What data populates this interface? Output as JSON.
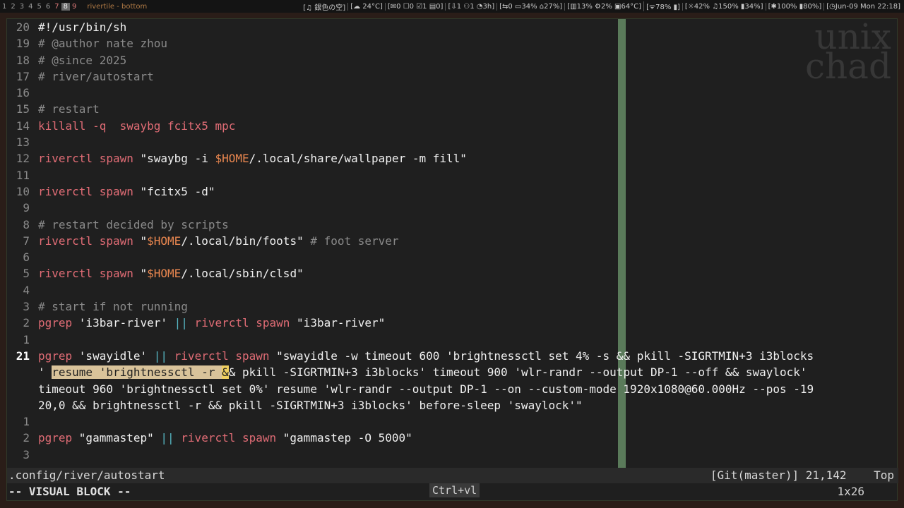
{
  "topbar": {
    "tags": [
      "1",
      "2",
      "3",
      "4",
      "5",
      "6",
      "7",
      "8",
      "9"
    ],
    "active_tag": "8",
    "window_title": "rivertile - bottom",
    "status": [
      "[♫ 銀色の空]",
      "[☁ 24°C]",
      "[✉0 ☐0 ☑1 ▤0]",
      "[⇩1 ⚇1 ◔3h]",
      "[⇆0 ▭34% ⌂27%]",
      "[▥13% ⚙2% ▣64°C]",
      "[ᯤ78% ▮]",
      "[☼42% ♫150% ▮34%]",
      "[✱100% ▮80%]",
      "[◷Jun-09 Mon 22:18]"
    ]
  },
  "watermark": {
    "line1": "unix",
    "line2": "chad"
  },
  "lines": [
    {
      "n": "20",
      "segs": [
        {
          "t": "#!/usr/bin/sh",
          "c": "str"
        }
      ]
    },
    {
      "n": "19",
      "segs": [
        {
          "t": "# @author nate zhou",
          "c": "cmt"
        }
      ]
    },
    {
      "n": "18",
      "segs": [
        {
          "t": "# @since 2025",
          "c": "cmt"
        }
      ]
    },
    {
      "n": "17",
      "segs": [
        {
          "t": "# river/autostart",
          "c": "cmt"
        }
      ]
    },
    {
      "n": "16",
      "segs": []
    },
    {
      "n": "15",
      "segs": [
        {
          "t": "# restart",
          "c": "cmt"
        }
      ]
    },
    {
      "n": "14",
      "segs": [
        {
          "t": "killall -q  swaybg fcitx5 mpc",
          "c": "cmd"
        }
      ]
    },
    {
      "n": "13",
      "segs": []
    },
    {
      "n": "12",
      "segs": [
        {
          "t": "riverctl spawn ",
          "c": "cmd"
        },
        {
          "t": "\"swaybg -i ",
          "c": "str"
        },
        {
          "t": "$HOME",
          "c": "var"
        },
        {
          "t": "/.local/share/wallpaper -m fill\"",
          "c": "str"
        }
      ]
    },
    {
      "n": "11",
      "segs": []
    },
    {
      "n": "10",
      "segs": [
        {
          "t": "riverctl spawn ",
          "c": "cmd"
        },
        {
          "t": "\"fcitx5 -d\"",
          "c": "str"
        }
      ]
    },
    {
      "n": "9",
      "segs": []
    },
    {
      "n": "8",
      "segs": [
        {
          "t": "# restart decided by scripts",
          "c": "cmt"
        }
      ]
    },
    {
      "n": "7",
      "segs": [
        {
          "t": "riverctl spawn ",
          "c": "cmd"
        },
        {
          "t": "\"",
          "c": "str"
        },
        {
          "t": "$HOME",
          "c": "var"
        },
        {
          "t": "/.local/bin/foots\"",
          "c": "str"
        },
        {
          "t": " # foot server",
          "c": "cmt"
        }
      ]
    },
    {
      "n": "6",
      "segs": []
    },
    {
      "n": "5",
      "segs": [
        {
          "t": "riverctl spawn ",
          "c": "cmd"
        },
        {
          "t": "\"",
          "c": "str"
        },
        {
          "t": "$HOME",
          "c": "var"
        },
        {
          "t": "/.local/sbin/clsd\"",
          "c": "str"
        }
      ]
    },
    {
      "n": "4",
      "segs": []
    },
    {
      "n": "3",
      "segs": [
        {
          "t": "# start if not running",
          "c": "cmt"
        }
      ]
    },
    {
      "n": "2",
      "segs": [
        {
          "t": "pgrep ",
          "c": "cmd"
        },
        {
          "t": "'i3bar-river' ",
          "c": "str"
        },
        {
          "t": "||",
          "c": "op"
        },
        {
          "t": " riverctl spawn ",
          "c": "cmd"
        },
        {
          "t": "\"i3bar-river\"",
          "c": "str"
        }
      ]
    },
    {
      "n": "1",
      "segs": []
    },
    {
      "n": "21",
      "cur": true,
      "segs": [
        {
          "t": "pgrep ",
          "c": "cmd"
        },
        {
          "t": "'swayidle' ",
          "c": "str"
        },
        {
          "t": "||",
          "c": "op"
        },
        {
          "t": " riverctl spawn ",
          "c": "cmd"
        },
        {
          "t": "\"swayidle -w timeout 600 'brightnessctl set 4% -s && pkill -SIGRTMIN+3 i3blocks",
          "c": "str"
        }
      ]
    },
    {
      "n": "",
      "segs": [
        {
          "t": "' ",
          "c": "str"
        },
        {
          "t": "resume 'brightnessctl -r ",
          "c": "sel"
        },
        {
          "t": "&",
          "c": "cursor"
        },
        {
          "t": "& pkill -SIGRTMIN+3 i3blocks' timeout 900 'wlr-randr --output DP-1 --off && swaylock'",
          "c": "str"
        }
      ]
    },
    {
      "n": "",
      "segs": [
        {
          "t": "timeout 960 'brightnessctl set 0%' resume 'wlr-randr --output DP-1 --on --custom-mode 1920x1080@60.000Hz --pos -19",
          "c": "str"
        }
      ]
    },
    {
      "n": "",
      "segs": [
        {
          "t": "20,0 && brightnessctl -r && pkill -SIGRTMIN+3 i3blocks' before-sleep 'swaylock'\"",
          "c": "str"
        }
      ]
    },
    {
      "n": "1",
      "segs": []
    },
    {
      "n": "2",
      "segs": [
        {
          "t": "pgrep ",
          "c": "cmd"
        },
        {
          "t": "\"gammastep\" ",
          "c": "str"
        },
        {
          "t": "||",
          "c": "op"
        },
        {
          "t": " riverctl spawn ",
          "c": "cmd"
        },
        {
          "t": "\"gammastep -O 5000\"",
          "c": "str"
        }
      ]
    },
    {
      "n": "3",
      "segs": []
    }
  ],
  "statusline": {
    "file": ".config/river/autostart",
    "right": "[Git(master)] 21,142    Top"
  },
  "cmdline": {
    "mode": "-- VISUAL BLOCK --",
    "keys": "Ctrl+vl",
    "selection_size": "1x26"
  }
}
